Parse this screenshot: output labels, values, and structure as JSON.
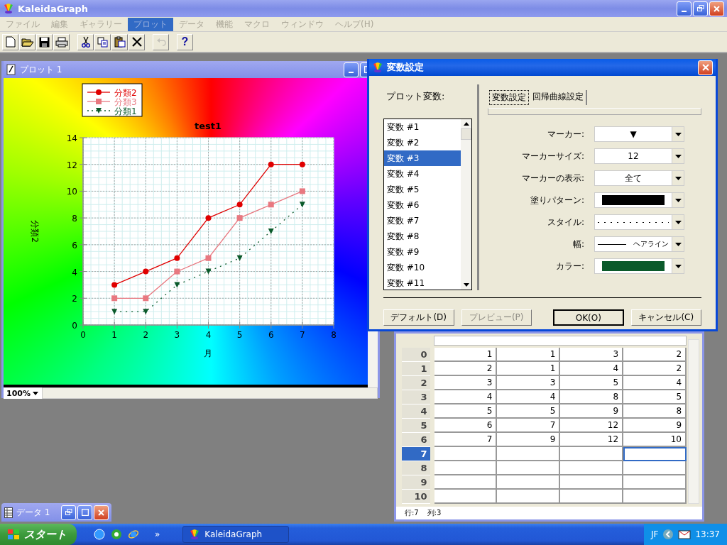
{
  "app_window": {
    "title": "KaleidaGraph"
  },
  "menu": [
    {
      "label": "ファイル",
      "selected": false,
      "disabled": true
    },
    {
      "label": "編集",
      "selected": false,
      "disabled": true
    },
    {
      "label": "ギャラリー",
      "selected": false,
      "disabled": true
    },
    {
      "label": "プロット",
      "selected": true,
      "disabled": true
    },
    {
      "label": "データ",
      "selected": false,
      "disabled": true
    },
    {
      "label": "機能",
      "selected": false,
      "disabled": true
    },
    {
      "label": "マクロ",
      "selected": false,
      "disabled": true
    },
    {
      "label": "ウィンドウ",
      "selected": false,
      "disabled": true
    },
    {
      "label": "ヘルプ(H)",
      "selected": false,
      "disabled": true
    }
  ],
  "toolbar": [
    {
      "kind": "new",
      "disabled": false
    },
    {
      "kind": "open",
      "disabled": false
    },
    {
      "kind": "save",
      "disabled": false
    },
    {
      "kind": "print",
      "disabled": false
    },
    {
      "kind": "cut",
      "disabled": false
    },
    {
      "kind": "copy",
      "disabled": false
    },
    {
      "kind": "paste",
      "disabled": false
    },
    {
      "kind": "delete",
      "disabled": false
    },
    {
      "kind": "undo",
      "disabled": true
    },
    {
      "kind": "help",
      "disabled": false,
      "label": "?"
    }
  ],
  "plot_window": {
    "title": "プロット 1",
    "zoom": "100%",
    "chart_data": {
      "type": "line",
      "title": "test1",
      "xlabel": "月",
      "ylabel": "分類2",
      "x": [
        1,
        2,
        3,
        4,
        5,
        6,
        7
      ],
      "xlim": [
        0,
        8
      ],
      "ylim": [
        0,
        14
      ],
      "xticks": [
        0,
        1,
        2,
        3,
        4,
        5,
        6,
        7,
        8
      ],
      "yticks": [
        0,
        2,
        4,
        6,
        8,
        10,
        12,
        14
      ],
      "grid": true,
      "legend": "top-left",
      "series": [
        {
          "name": "分類2",
          "color": "#e00000",
          "marker": "circle",
          "line_style": "solid",
          "values": [
            3,
            4,
            5,
            8,
            9,
            12,
            12
          ]
        },
        {
          "name": "分類3",
          "color": "#e87880",
          "marker": "square",
          "line_style": "solid",
          "values": [
            2,
            2,
            4,
            5,
            8,
            9,
            10
          ]
        },
        {
          "name": "分類1",
          "color": "#0b5a2b",
          "marker": "triangle",
          "line_style": "dashed",
          "values": [
            1,
            1,
            3,
            4,
            5,
            7,
            9
          ]
        }
      ]
    }
  },
  "dialog": {
    "title": "変数設定",
    "list_label": "プロット変数:",
    "variables": [
      {
        "label": "変数 #1",
        "selected": false
      },
      {
        "label": "変数 #2",
        "selected": false
      },
      {
        "label": "変数 #3",
        "selected": true
      },
      {
        "label": "変数 #4",
        "selected": false
      },
      {
        "label": "変数 #5",
        "selected": false
      },
      {
        "label": "変数 #6",
        "selected": false
      },
      {
        "label": "変数 #7",
        "selected": false
      },
      {
        "label": "変数 #8",
        "selected": false
      },
      {
        "label": "変数 #9",
        "selected": false
      },
      {
        "label": "変数 #10",
        "selected": false
      },
      {
        "label": "変数 #11",
        "selected": false
      }
    ],
    "tabs": [
      {
        "label": "変数設定",
        "selected": true
      },
      {
        "label": "回帰曲線設定",
        "selected": false
      }
    ],
    "fields": [
      {
        "label": "マーカー:",
        "kind": "text",
        "value": "▼"
      },
      {
        "label": "マーカーサイズ:",
        "kind": "text",
        "value": "12"
      },
      {
        "label": "マーカーの表示:",
        "kind": "text",
        "value": "全て"
      },
      {
        "label": "塗りパターン:",
        "kind": "swatch",
        "color": "#000000"
      },
      {
        "label": "スタイル:",
        "kind": "dashes"
      },
      {
        "label": "幅:",
        "kind": "line",
        "value": "ヘアライン"
      },
      {
        "label": "カラー:",
        "kind": "swatch",
        "color": "#0b5a2b"
      }
    ],
    "buttons": [
      {
        "label": "デフォルト(D)",
        "disabled": false,
        "default": false
      },
      {
        "label": "プレビュー(P)",
        "disabled": true,
        "default": false
      },
      {
        "label": "OK(O)",
        "disabled": false,
        "default": true
      },
      {
        "label": "キャンセル(C)",
        "disabled": false,
        "default": false
      }
    ]
  },
  "data_window": {
    "rows": [
      {
        "label": "0",
        "selected": false,
        "cells": [
          "1",
          "1",
          "3",
          "2"
        ]
      },
      {
        "label": "1",
        "selected": false,
        "cells": [
          "2",
          "1",
          "4",
          "2"
        ]
      },
      {
        "label": "2",
        "selected": false,
        "cells": [
          "3",
          "3",
          "5",
          "4"
        ]
      },
      {
        "label": "3",
        "selected": false,
        "cells": [
          "4",
          "4",
          "8",
          "5"
        ]
      },
      {
        "label": "4",
        "selected": false,
        "cells": [
          "5",
          "5",
          "9",
          "8"
        ]
      },
      {
        "label": "5",
        "selected": false,
        "cells": [
          "6",
          "7",
          "12",
          "9"
        ]
      },
      {
        "label": "6",
        "selected": false,
        "cells": [
          "7",
          "9",
          "12",
          "10"
        ]
      },
      {
        "label": "7",
        "selected": true,
        "cells": [
          {
            "selected": false
          },
          {
            "selected": false
          },
          {
            "selected": false
          },
          {
            "selected": true
          }
        ]
      },
      {
        "label": "8",
        "selected": false,
        "cells": [
          {
            "selected": false
          },
          {
            "selected": false
          },
          {
            "selected": false
          },
          {
            "selected": false
          }
        ]
      },
      {
        "label": "9",
        "selected": false,
        "cells": [
          {
            "selected": false
          },
          {
            "selected": false
          },
          {
            "selected": false
          },
          {
            "selected": false
          }
        ]
      },
      {
        "label": "10",
        "selected": false,
        "cells": [
          {
            "selected": false
          },
          {
            "selected": false
          },
          {
            "selected": false
          },
          {
            "selected": false
          }
        ]
      }
    ],
    "status_row": "行:7",
    "status_col": "列:3"
  },
  "minimized_window": {
    "title": "データ 1"
  },
  "taskbar": {
    "start": "スタート",
    "chevron": "»",
    "task": "KaleidaGraph",
    "ime": "JF",
    "clock": "13:37"
  }
}
